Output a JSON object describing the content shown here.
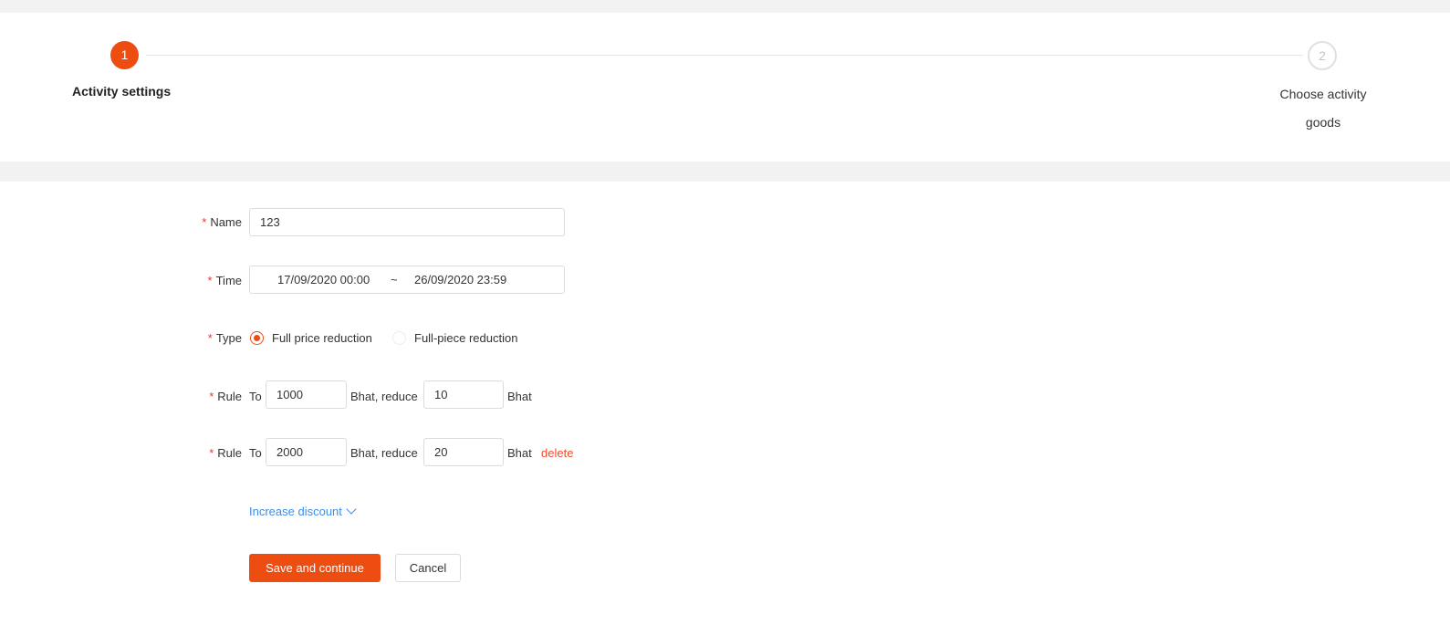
{
  "steps": [
    {
      "number": "1",
      "label": "Activity settings",
      "state": "active"
    },
    {
      "number": "2",
      "label_line1": "Choose activity",
      "label_line2": "goods",
      "state": "pending"
    }
  ],
  "form": {
    "required_mark": "*",
    "name": {
      "label": "Name",
      "value": "123"
    },
    "time": {
      "label": "Time",
      "start": "17/09/2020 00:00",
      "separator": "~",
      "end": "26/09/2020 23:59"
    },
    "type": {
      "label": "Type",
      "options": [
        {
          "label": "Full price reduction",
          "selected": true
        },
        {
          "label": "Full-piece reduction",
          "selected": false
        }
      ]
    },
    "rules": [
      {
        "label": "Rule",
        "prefix": "To",
        "threshold": "1000",
        "middle": "Bhat, reduce",
        "reduce": "10",
        "unit": "Bhat"
      },
      {
        "label": "Rule",
        "prefix": "To",
        "threshold": "2000",
        "middle": "Bhat, reduce",
        "reduce": "20",
        "unit": "Bhat",
        "delete_label": "delete"
      }
    ],
    "increase_label": "Increase discount",
    "save_label": "Save and continue",
    "cancel_label": "Cancel"
  },
  "colors": {
    "accent": "#ee4d11",
    "link": "#3b8ee8",
    "required": "#e33333",
    "background_band": "#f2f2f2"
  },
  "icons": {
    "increase_chevron": "chevron-down-icon"
  }
}
